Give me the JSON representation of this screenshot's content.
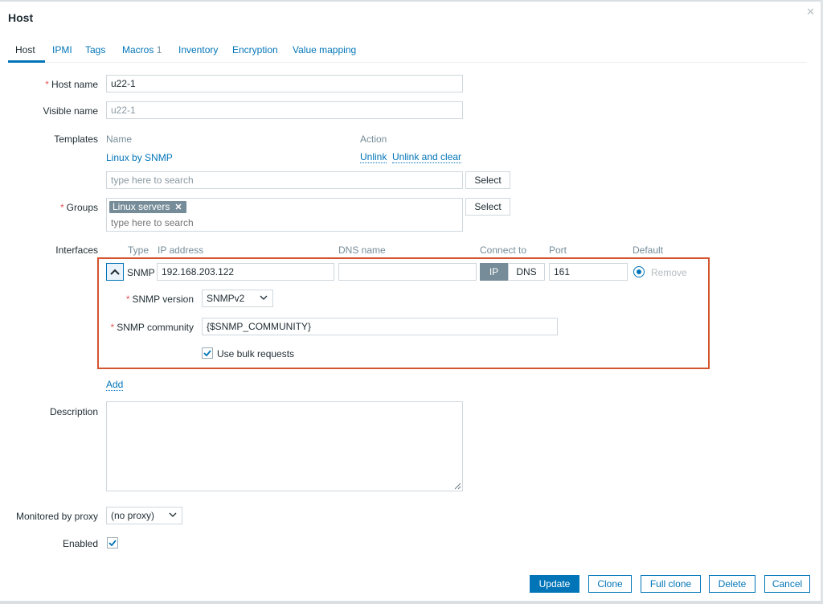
{
  "dialog": {
    "title": "Host"
  },
  "tabs": [
    {
      "label": "Host"
    },
    {
      "label": "IPMI"
    },
    {
      "label": "Tags"
    },
    {
      "label": "Macros",
      "count": "1"
    },
    {
      "label": "Inventory"
    },
    {
      "label": "Encryption"
    },
    {
      "label": "Value mapping"
    }
  ],
  "form": {
    "host_name": {
      "label": "Host name",
      "required_mark": "*",
      "value": "u22-1"
    },
    "visible_name": {
      "label": "Visible name",
      "placeholder": "u22-1"
    },
    "templates": {
      "label": "Templates",
      "col_name": "Name",
      "col_action": "Action",
      "items": [
        {
          "name": "Linux by SNMP",
          "unlink": "Unlink",
          "unlink_clear": "Unlink and clear"
        }
      ],
      "search_placeholder": "type here to search",
      "select_label": "Select"
    },
    "groups": {
      "label": "Groups",
      "required_mark": "*",
      "chips": [
        {
          "label": "Linux servers",
          "remove": "✕"
        }
      ],
      "search_placeholder": "type here to search",
      "select_label": "Select"
    },
    "interfaces": {
      "label": "Interfaces",
      "headers": {
        "type": "Type",
        "ip": "IP address",
        "dns": "DNS name",
        "connect_to": "Connect to",
        "port": "Port",
        "default": "Default"
      },
      "row": {
        "type": "SNMP",
        "ip": "192.168.203.122",
        "dns": "",
        "connect_ip": "IP",
        "connect_dns": "DNS",
        "port": "161",
        "remove": "Remove"
      },
      "snmp": {
        "version_label": "SNMP version",
        "version_value": "SNMPv2",
        "community_label": "SNMP community",
        "community_value": "{$SNMP_COMMUNITY}",
        "bulk_label": "Use bulk requests",
        "required_mark": "*"
      },
      "add_label": "Add"
    },
    "description": {
      "label": "Description",
      "value": ""
    },
    "proxy": {
      "label": "Monitored by proxy",
      "value": "(no proxy)"
    },
    "enabled": {
      "label": "Enabled"
    }
  },
  "footer": {
    "update": "Update",
    "clone": "Clone",
    "full_clone": "Full clone",
    "delete": "Delete",
    "cancel": "Cancel"
  },
  "colors": {
    "accent": "#0275b8",
    "required": "#e45959",
    "highlight_border": "#d4542f",
    "chip": "#768d99"
  },
  "icons": {
    "close": "close-icon",
    "collapse": "chevron-up-icon",
    "dropdown": "chevron-down-icon",
    "check": "check-icon",
    "chip_remove": "close-icon"
  }
}
